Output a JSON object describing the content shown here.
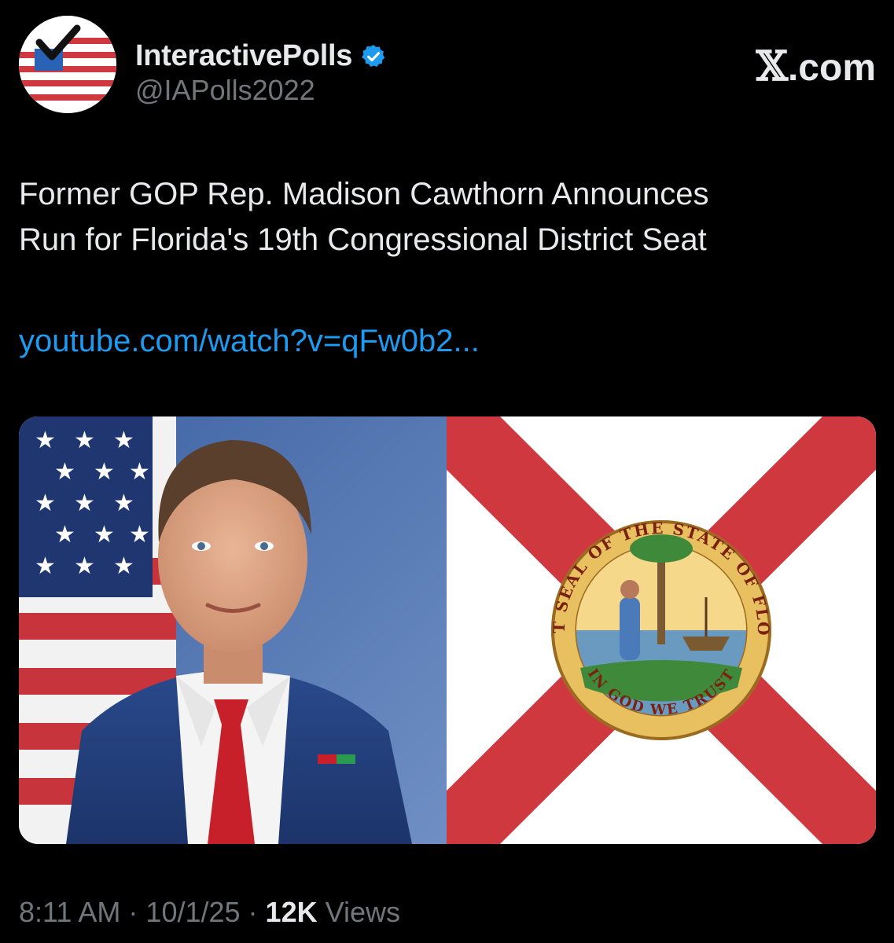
{
  "author": {
    "display_name": "InteractivePolls",
    "handle": "@IAPolls2022",
    "verified": true,
    "avatar_icon": "check-flag-logo-icon"
  },
  "source": {
    "glyph": "𝕏",
    "suffix": ".com"
  },
  "tweet": {
    "text_line_1": "Former GOP Rep. Madison Cawthorn Announces",
    "text_line_2": "Run for Florida's 19th Congressional District Seat",
    "link": "youtube.com/watch?v=qFw0b2..."
  },
  "media": {
    "left_image": "portrait-photo",
    "right_image": "florida-flag",
    "seal_top_text": "GREAT SEAL OF THE STATE OF FLORIDA",
    "seal_bottom_text": "IN GOD WE TRUST"
  },
  "meta": {
    "time": "8:11 AM",
    "separator": "·",
    "date": "10/1/25",
    "views_count": "12K",
    "views_label": "Views"
  },
  "colors": {
    "background": "#000000",
    "text": "#e7e9ea",
    "muted": "#71767b",
    "link": "#1d9bf0",
    "flag_red": "#d0383f"
  }
}
